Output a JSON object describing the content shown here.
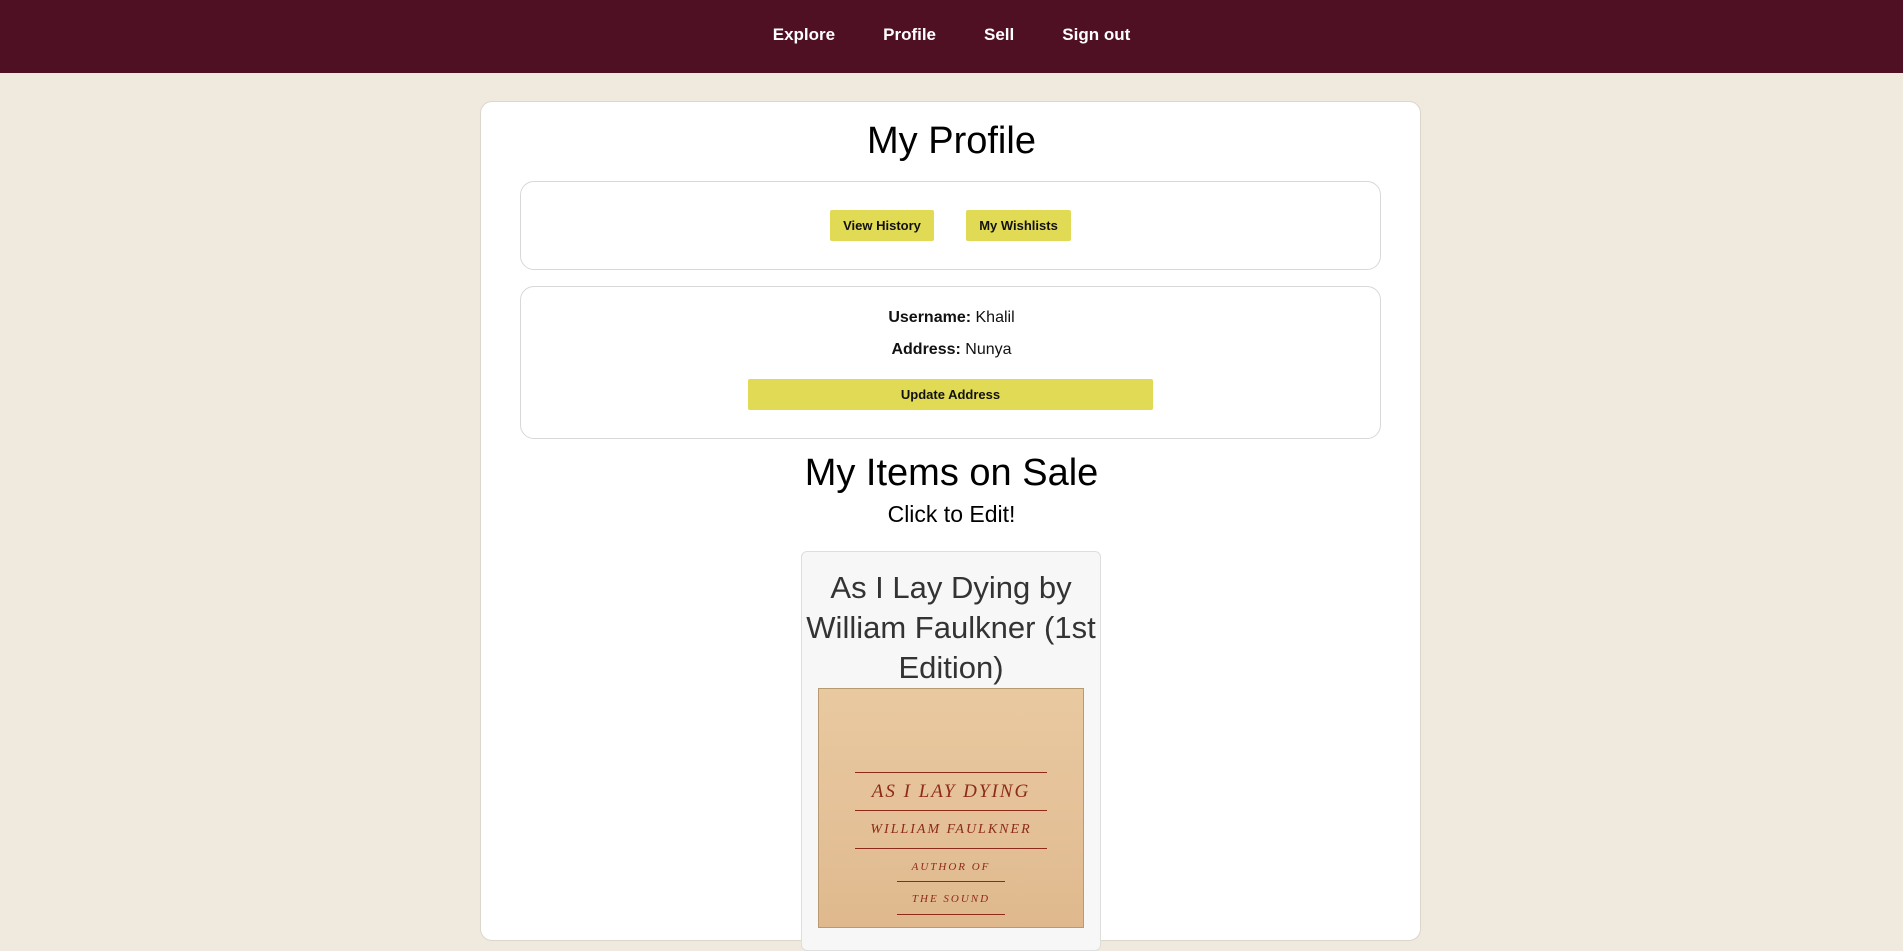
{
  "nav": {
    "items": [
      "Explore",
      "Profile",
      "Sell",
      "Sign out"
    ]
  },
  "profile": {
    "title": "My Profile",
    "buttons": {
      "history": "View History",
      "wishlists": "My Wishlists"
    },
    "username_label": "Username:",
    "username_value": "Khalil",
    "address_label": "Address:",
    "address_value": "Nunya",
    "update_address": "Update Address"
  },
  "sale": {
    "title": "My Items on Sale",
    "subtitle": "Click to Edit!",
    "items": [
      {
        "title": "As I Lay Dying by William Faulkner (1st Edition)",
        "cover": {
          "title": "AS I LAY DYING",
          "author": "WILLIAM FAULKNER",
          "line1": "AUTHOR OF",
          "line2": "THE SOUND"
        }
      }
    ]
  },
  "colors": {
    "nav_bg": "#4f1024",
    "page_bg": "#f0e9de",
    "button_bg": "#e0da55",
    "cover_ink": "#8d2a1a"
  }
}
